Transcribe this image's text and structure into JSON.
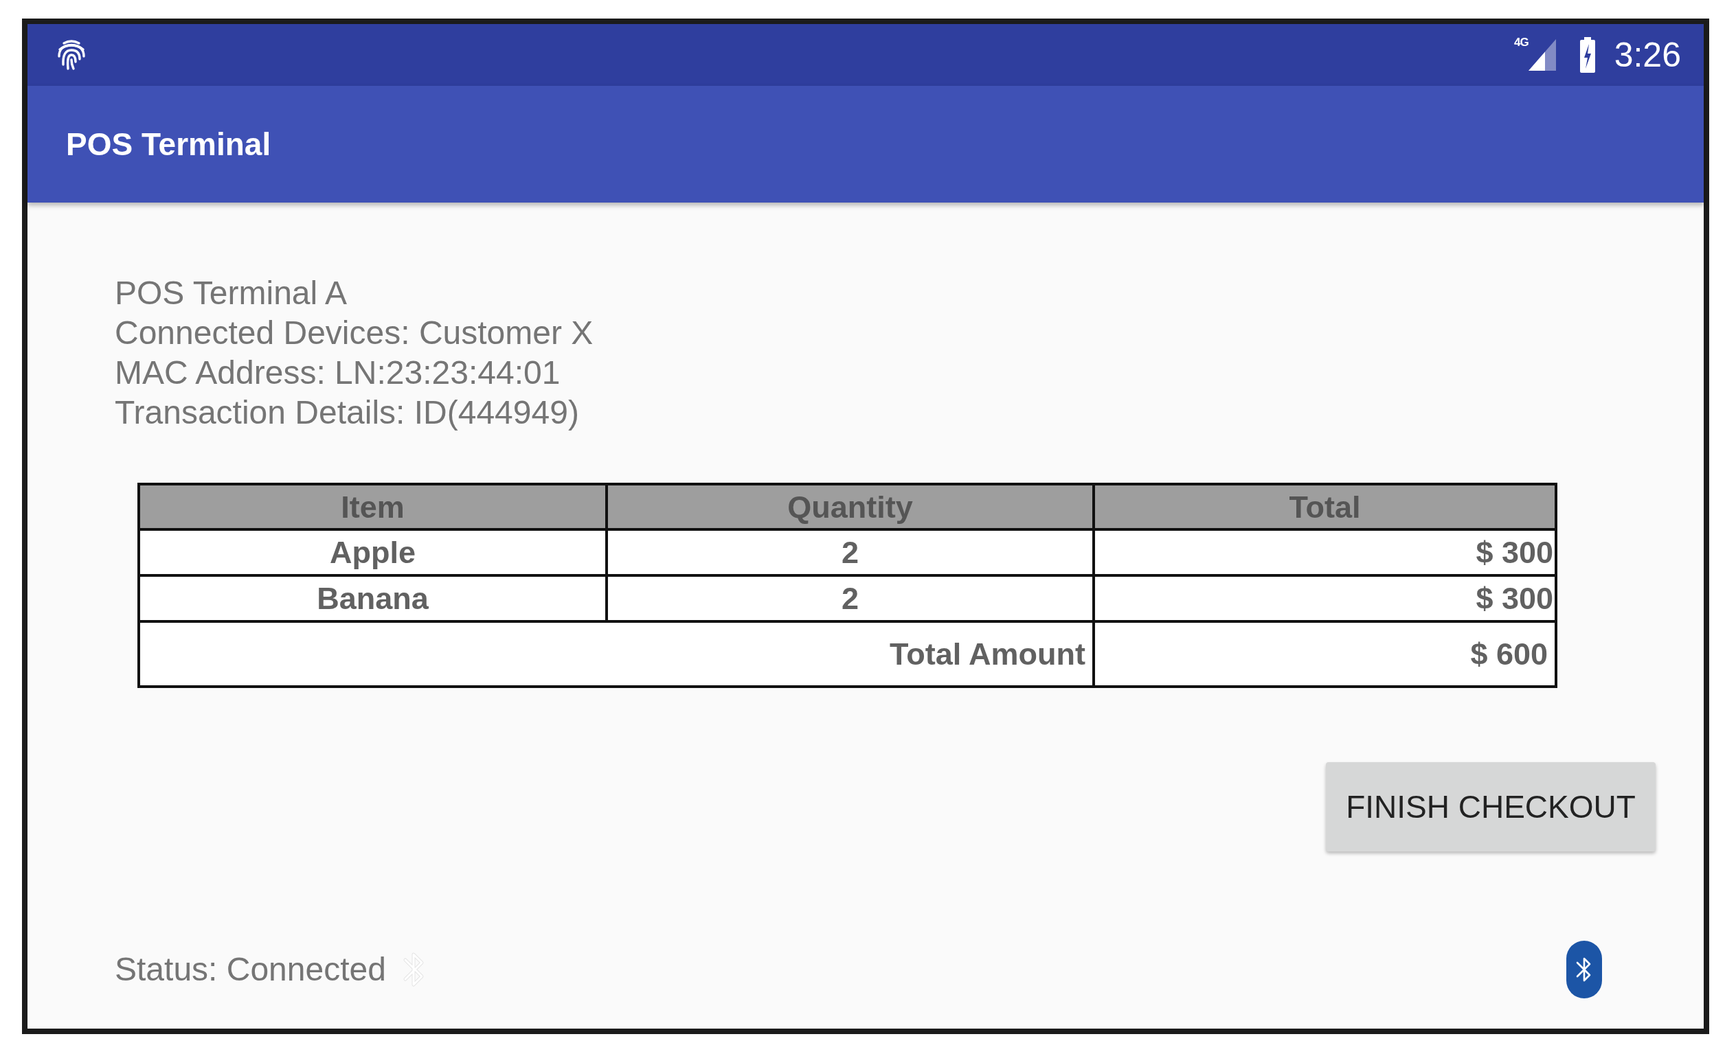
{
  "status_bar": {
    "network_type": "4G",
    "time": "3:26"
  },
  "app_bar": {
    "title": "POS Terminal"
  },
  "info_lines": [
    "POS Terminal A",
    "Connected Devices: Customer X",
    "MAC Address: LN:23:23:44:01",
    "Transaction Details: ID(444949)"
  ],
  "table": {
    "columns": [
      "Item",
      "Quantity",
      "Total"
    ],
    "rows": [
      {
        "cells": [
          "Apple",
          "2",
          "$ 300"
        ]
      },
      {
        "cells": [
          "Banana",
          "2",
          "$ 300"
        ]
      }
    ],
    "summary": {
      "label": "Total Amount",
      "value": "$ 600"
    }
  },
  "checkout_button": {
    "label": "FINISH CHECKOUT"
  },
  "footer": {
    "status": "Status: Connected"
  }
}
